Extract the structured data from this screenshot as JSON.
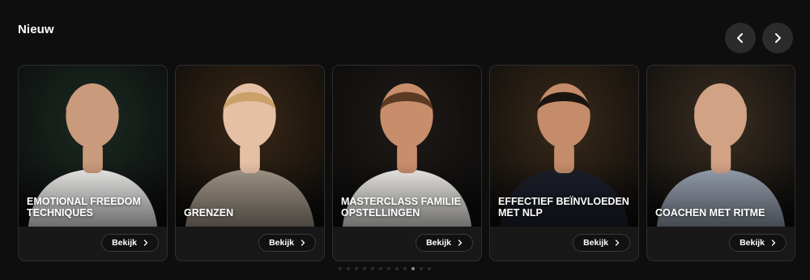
{
  "section": {
    "title": "Nieuw"
  },
  "nav": {
    "prev_icon": "chevron-left-icon",
    "next_icon": "chevron-right-icon"
  },
  "cards": [
    {
      "title_line1": "EMOTIONAL FREEDOM",
      "title_line2": "TECHNIQUES",
      "cta": "Bekijk",
      "bg_color": "#1c2a22",
      "shirt_color": "#f1f0ee",
      "skin_color": "#c99a7c",
      "hair_color": "#c99a7c"
    },
    {
      "title_line1": "GRENZEN",
      "title_line2": "",
      "cta": "Bekijk",
      "bg_color": "#3a2816",
      "shirt_color": "#a59a8c",
      "skin_color": "#e6c0a5",
      "hair_color": "#c9a169"
    },
    {
      "title_line1": "MASTERCLASS FAMILIE",
      "title_line2": "OPSTELLINGEN",
      "cta": "Bekijk",
      "bg_color": "#1e1a17",
      "shirt_color": "#f2f0ec",
      "skin_color": "#c88e6c",
      "hair_color": "#5a3a23"
    },
    {
      "title_line1": "EFFECTIEF BEÏNVLOEDEN",
      "title_line2": "MET NLP",
      "cta": "Bekijk",
      "bg_color": "#3a2a1a",
      "shirt_color": "#1b1f2a",
      "skin_color": "#c48c6a",
      "hair_color": "#1a1410"
    },
    {
      "title_line1": "COACHEN MET RITME",
      "title_line2": "",
      "cta": "Bekijk",
      "bg_color": "#3a2e22",
      "shirt_color": "#9aa3b2",
      "skin_color": "#d2a284",
      "hair_color": "#d2a284"
    }
  ],
  "pagination": {
    "count": 12,
    "active_index": 9
  }
}
